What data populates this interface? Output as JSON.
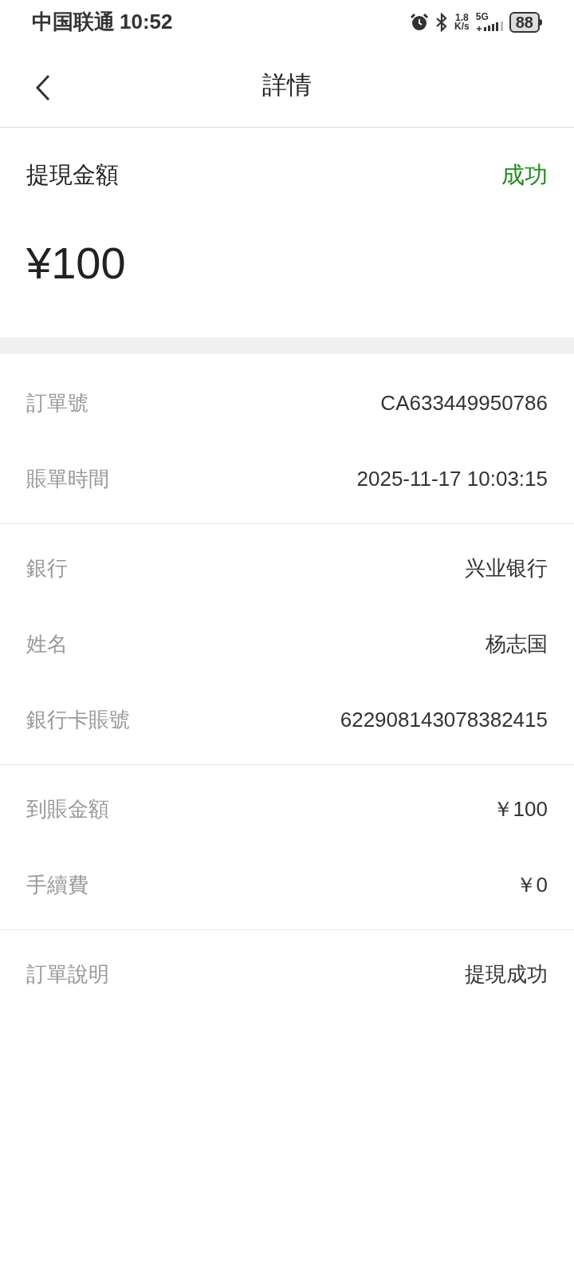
{
  "status_bar": {
    "carrier": "中国联通",
    "time": "10:52",
    "speed": "1.8",
    "speed_unit": "K/s",
    "network": "5G",
    "battery": "88"
  },
  "header": {
    "title": "詳情"
  },
  "summary": {
    "label": "提現金額",
    "status": "成功",
    "amount": "¥100"
  },
  "sections": [
    {
      "rows": [
        {
          "label": "訂單號",
          "value": "CA633449950786"
        },
        {
          "label": "賬單時間",
          "value": "2025-11-17 10:03:15"
        }
      ]
    },
    {
      "rows": [
        {
          "label": "銀行",
          "value": "兴业银行"
        },
        {
          "label": "姓名",
          "value": "杨志国"
        },
        {
          "label": "銀行卡賬號",
          "value": "622908143078382415"
        }
      ]
    },
    {
      "rows": [
        {
          "label": "到賬金額",
          "value": "￥100"
        },
        {
          "label": "手續費",
          "value": "￥0"
        }
      ]
    },
    {
      "rows": [
        {
          "label": "訂單說明",
          "value": "提現成功"
        }
      ]
    }
  ]
}
